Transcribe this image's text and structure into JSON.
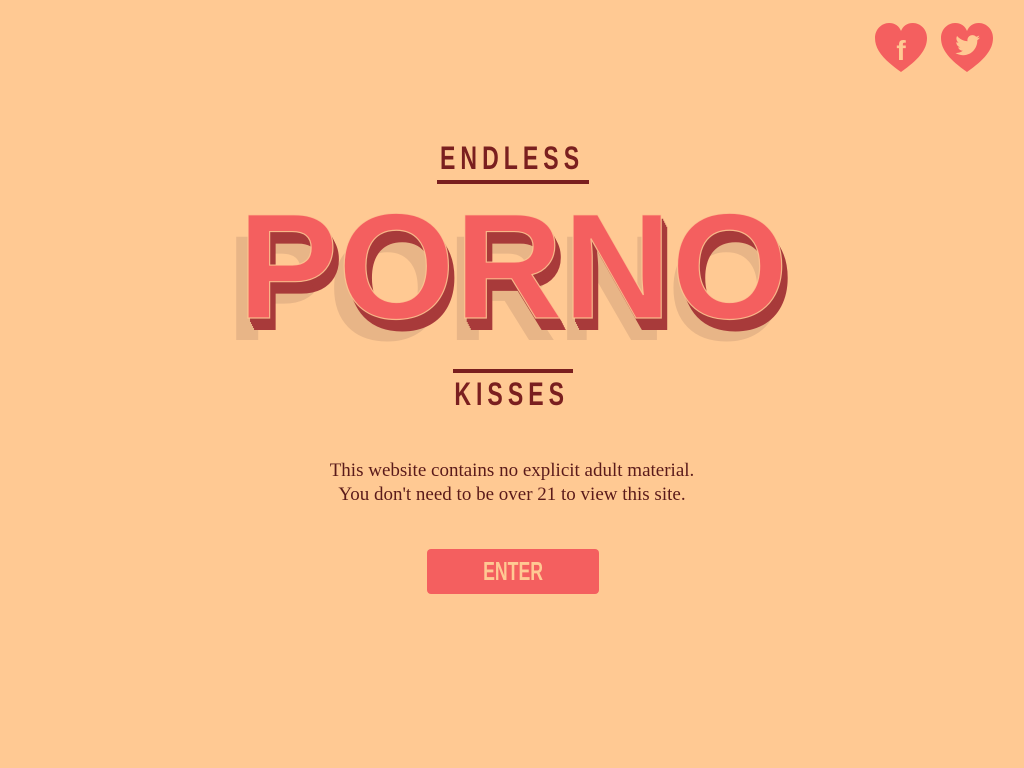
{
  "social": {
    "facebook_label": "f",
    "heart_color": "#f45f5f",
    "glyph_color": "#ffc993"
  },
  "logo": {
    "top_word": "ENDLESS",
    "main_word": "PORNO",
    "bottom_word": "KISSES",
    "main_color": "#f45f5f",
    "extrude_color": "#a83a3a",
    "shadow_color": "#e8b587",
    "dark_color": "#7a1f1f"
  },
  "disclaimer": {
    "line1": "This website contains no explicit adult material.",
    "line2": "You don't need to be over 21 to view this site."
  },
  "enter_button": {
    "label": "ENTER"
  },
  "colors": {
    "background": "#ffc993",
    "accent": "#f45f5f"
  }
}
